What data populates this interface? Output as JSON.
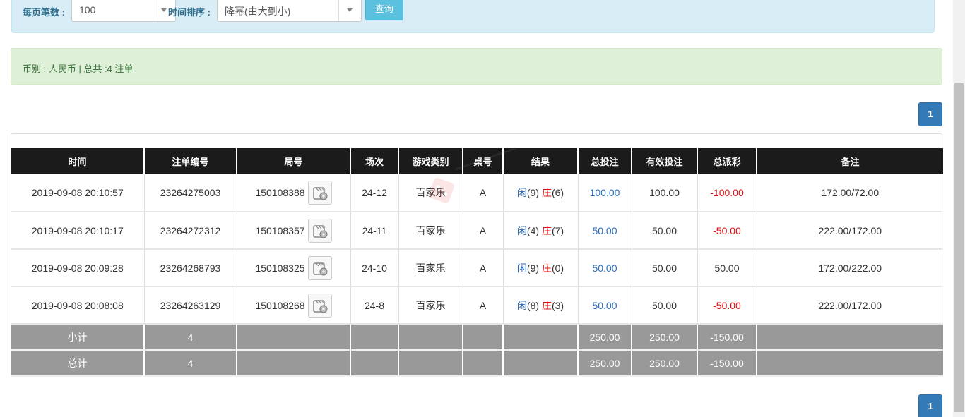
{
  "filter": {
    "page_size_label": "每页笔数 :",
    "page_size_value": "100",
    "sort_label": "时间排序 :",
    "sort_value": "降幂(由大到小)",
    "query_button": "查询"
  },
  "summary": {
    "text": "币别 : 人民币 | 总共 :4 注单"
  },
  "pagination": {
    "current_page": "1"
  },
  "table": {
    "headers": [
      "时间",
      "注单编号",
      "局号",
      "场次",
      "游戏类别",
      "桌号",
      "结果",
      "总投注",
      "有效投注",
      "总派彩",
      "备注"
    ],
    "rows": [
      {
        "time": "2019-09-08 20:10:57",
        "bet_id": "23264275003",
        "round": "150108388",
        "session": "24-12",
        "game": "百家乐",
        "table": "A",
        "player_label": "闲",
        "player_score": "(9)",
        "banker_label": "庄",
        "banker_score": "(6)",
        "total_bet": "100.00",
        "valid_bet": "100.00",
        "payout": "-100.00",
        "note": "172.00/72.00"
      },
      {
        "time": "2019-09-08 20:10:17",
        "bet_id": "23264272312",
        "round": "150108357",
        "session": "24-11",
        "game": "百家乐",
        "table": "A",
        "player_label": "闲",
        "player_score": "(4)",
        "banker_label": "庄",
        "banker_score": "(7)",
        "total_bet": "50.00",
        "valid_bet": "50.00",
        "payout": "-50.00",
        "note": "222.00/172.00"
      },
      {
        "time": "2019-09-08 20:09:28",
        "bet_id": "23264268793",
        "round": "150108325",
        "session": "24-10",
        "game": "百家乐",
        "table": "A",
        "player_label": "闲",
        "player_score": "(9)",
        "banker_label": "庄",
        "banker_score": "(0)",
        "total_bet": "50.00",
        "valid_bet": "50.00",
        "payout": "50.00",
        "note": "172.00/222.00"
      },
      {
        "time": "2019-09-08 20:08:08",
        "bet_id": "23264263129",
        "round": "150108268",
        "session": "24-8",
        "game": "百家乐",
        "table": "A",
        "player_label": "闲",
        "player_score": "(8)",
        "banker_label": "庄",
        "banker_score": "(3)",
        "total_bet": "50.00",
        "valid_bet": "50.00",
        "payout": "-50.00",
        "note": "222.00/172.00"
      }
    ],
    "subtotal": {
      "label": "小计",
      "count": "4",
      "total_bet": "250.00",
      "valid_bet": "250.00",
      "payout": "-150.00"
    },
    "grandtotal": {
      "label": "总计",
      "count": "4",
      "total_bet": "250.00",
      "valid_bet": "250.00",
      "payout": "-150.00"
    }
  },
  "icons": {
    "video": "video-replay-icon",
    "caret": "chevron-down-icon"
  },
  "colors": {
    "header_bg": "#1b1b1b",
    "total_bg": "#999999",
    "positive_blue": "#2a6ebf",
    "negative_red": "#e01010",
    "filter_bg": "#d9edf7",
    "alert_bg": "#dff0d8",
    "primary": "#337ab7",
    "info": "#5bc0de"
  }
}
